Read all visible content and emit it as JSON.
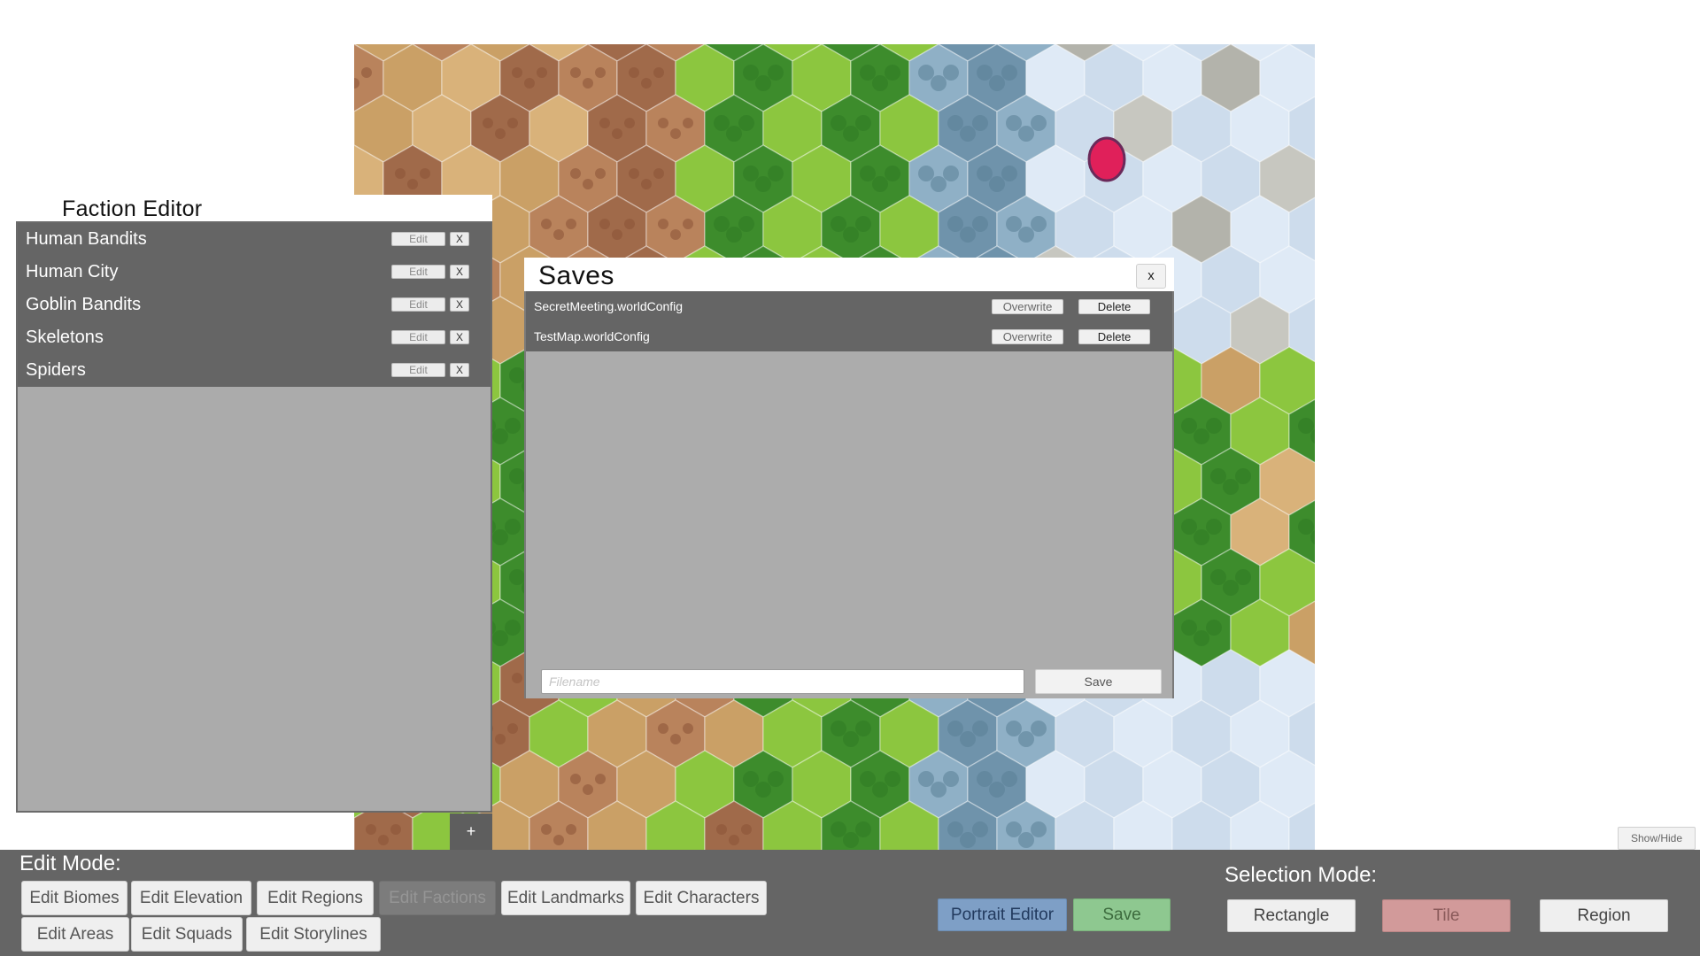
{
  "faction_editor": {
    "title": "Faction Editor",
    "factions": [
      {
        "name": "Human Bandits",
        "edit_label": "Edit",
        "remove_label": "X"
      },
      {
        "name": "Human City",
        "edit_label": "Edit",
        "remove_label": "X"
      },
      {
        "name": "Goblin Bandits",
        "edit_label": "Edit",
        "remove_label": "X"
      },
      {
        "name": "Skeletons",
        "edit_label": "Edit",
        "remove_label": "X"
      },
      {
        "name": "Spiders",
        "edit_label": "Edit",
        "remove_label": "X"
      }
    ],
    "add_label": "+"
  },
  "saves_dialog": {
    "title": "Saves",
    "close_label": "x",
    "files": [
      {
        "name": "SecretMeeting.worldConfig",
        "overwrite_label": "Overwrite",
        "delete_label": "Delete"
      },
      {
        "name": "TestMap.worldConfig",
        "overwrite_label": "Overwrite",
        "delete_label": "Delete"
      }
    ],
    "filename_placeholder": "Filename",
    "filename_value": "",
    "save_label": "Save"
  },
  "bottom_bar": {
    "edit_mode_label": "Edit Mode:",
    "edit_buttons": [
      {
        "label": "Edit Biomes",
        "enabled": true
      },
      {
        "label": "Edit Elevation",
        "enabled": true
      },
      {
        "label": "Edit Regions",
        "enabled": true
      },
      {
        "label": "Edit Factions",
        "enabled": false
      },
      {
        "label": "Edit Landmarks",
        "enabled": true
      },
      {
        "label": "Edit Characters",
        "enabled": true
      },
      {
        "label": "Edit Areas",
        "enabled": true
      },
      {
        "label": "Edit Squads",
        "enabled": true
      },
      {
        "label": "Edit Storylines",
        "enabled": true
      }
    ],
    "portrait_editor_label": "Portrait Editor",
    "save_label": "Save",
    "selection_mode_label": "Selection Mode:",
    "selection_buttons": [
      {
        "label": "Rectangle",
        "active": false
      },
      {
        "label": "Tile",
        "active": true
      },
      {
        "label": "Region",
        "active": false
      }
    ]
  },
  "show_hide_label": "Show/Hide",
  "colors": {
    "panel_dark": "#656565",
    "panel_light": "#acacac",
    "portrait_button": "#7e9fc6",
    "save_button": "#8ec890",
    "selection_active": "#d29a9a"
  }
}
